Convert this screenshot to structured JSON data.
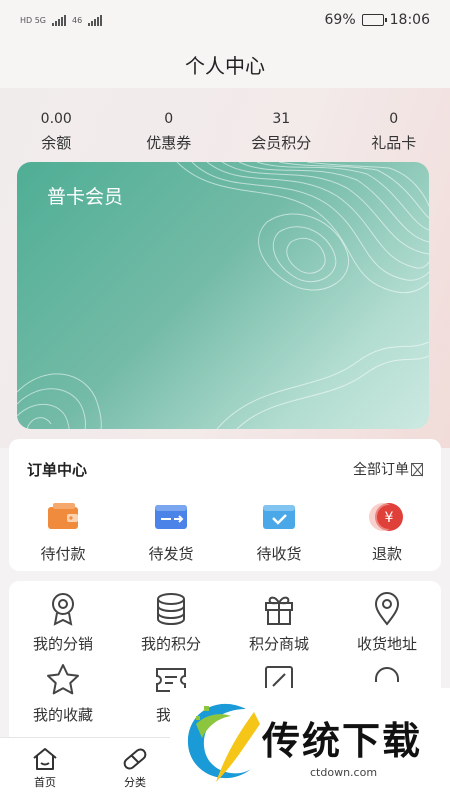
{
  "status_bar": {
    "left_sim1": "HD 5G",
    "left_sim2": "46",
    "battery_percent": "69%",
    "battery_level": 0.69,
    "time": "18:06"
  },
  "header": {
    "title": "个人中心"
  },
  "stats": [
    {
      "value": "0.00",
      "label": "余额"
    },
    {
      "value": "0",
      "label": "优惠券"
    },
    {
      "value": "31",
      "label": "会员积分"
    },
    {
      "value": "0",
      "label": "礼品卡"
    }
  ],
  "member_card": {
    "title": "普卡会员"
  },
  "orders": {
    "title": "订单中心",
    "all_label": "全部订单",
    "items": [
      {
        "label": "待付款",
        "icon": "wallet-icon",
        "color": "#f08a3c"
      },
      {
        "label": "待发货",
        "icon": "ship-box-icon",
        "color": "#4b83e8"
      },
      {
        "label": "待收货",
        "icon": "receive-box-icon",
        "color": "#4aa8e8"
      },
      {
        "label": "退款",
        "icon": "refund-yen-icon",
        "color": "#e0403a"
      }
    ]
  },
  "tools": {
    "row1": [
      {
        "label": "我的分销",
        "icon": "medal-icon"
      },
      {
        "label": "我的积分",
        "icon": "coin-stack-icon"
      },
      {
        "label": "积分商城",
        "icon": "gift-icon"
      },
      {
        "label": "收货地址",
        "icon": "location-pin-icon"
      }
    ],
    "row2": [
      {
        "label": "我的收藏",
        "icon": "star-icon"
      },
      {
        "label": "我的",
        "icon": "ticket-icon"
      },
      {
        "label": "",
        "icon": "edit-icon"
      },
      {
        "label": "",
        "icon": "headset-icon"
      }
    ]
  },
  "tabbar": {
    "items": [
      {
        "label": "首页",
        "icon": "home-icon"
      },
      {
        "label": "分类",
        "icon": "capsule-icon"
      }
    ]
  },
  "watermark": {
    "text": "传统下载",
    "url": "ctdown.com"
  }
}
